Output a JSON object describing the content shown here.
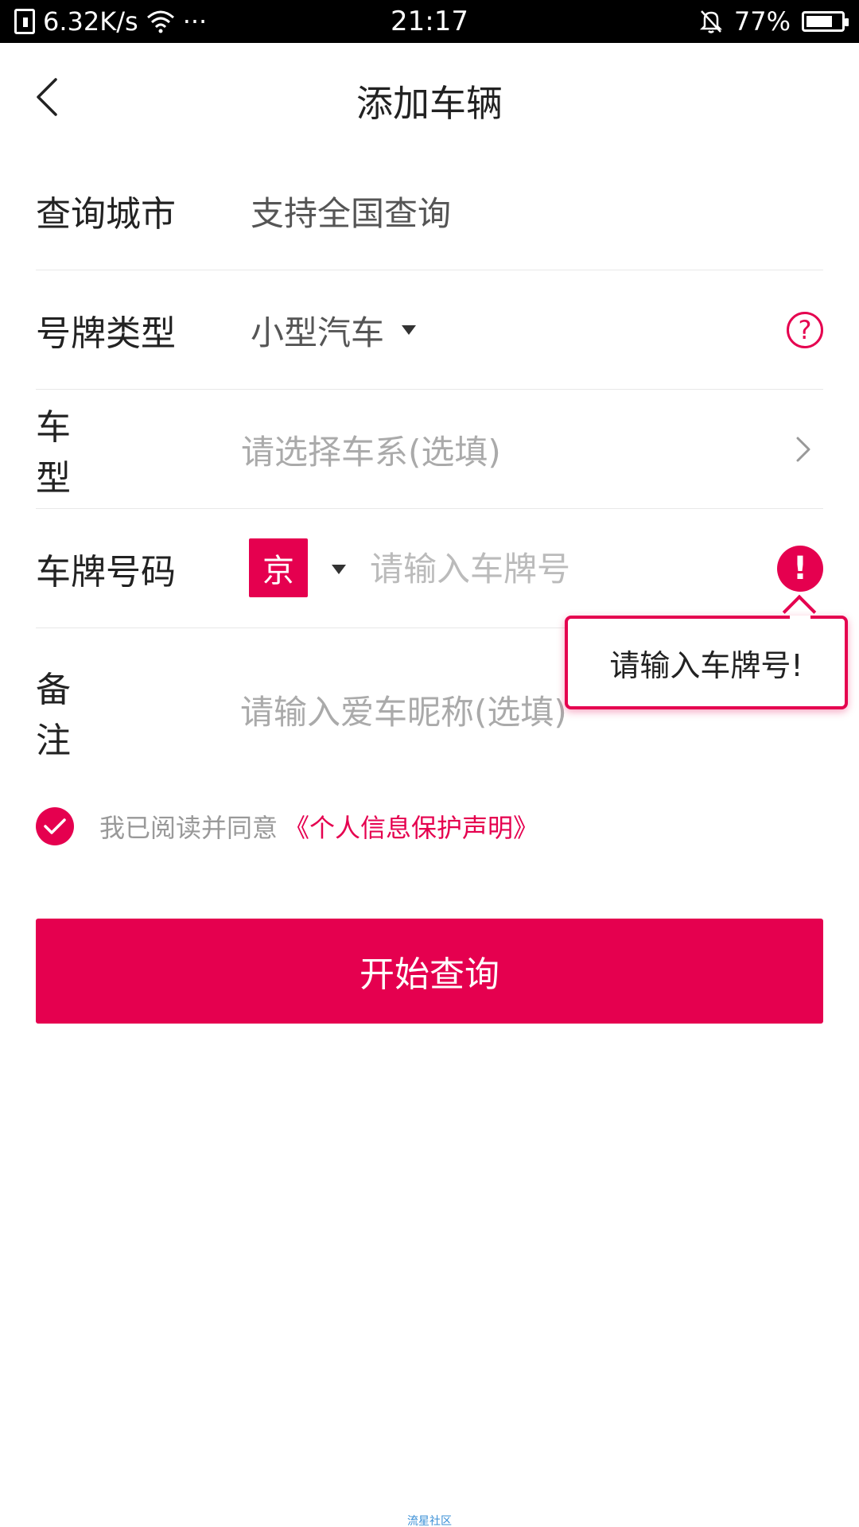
{
  "status_bar": {
    "network_speed": "6.32K/s",
    "more": "···",
    "time": "21:17",
    "battery_percent_text": "77%",
    "battery_level": 0.77
  },
  "header": {
    "title": "添加车辆",
    "back_icon": "chevron-left-icon"
  },
  "form": {
    "city": {
      "label": "查询城市",
      "value": "支持全国查询"
    },
    "plate_type": {
      "label": "号牌类型",
      "value": "小型汽车",
      "help_icon": "question-circle-icon",
      "help_glyph": "?"
    },
    "vehicle_model": {
      "label": "车型",
      "placeholder": "请选择车系(选填)"
    },
    "plate_number": {
      "label": "车牌号码",
      "province": "京",
      "placeholder": "请输入车牌号",
      "value": "",
      "error_glyph": "!"
    },
    "remark": {
      "label": "备注",
      "placeholder": "请输入爱车昵称(选填)",
      "value": ""
    }
  },
  "tooltip": {
    "message": "请输入车牌号!"
  },
  "agreement": {
    "checked": true,
    "text": "我已阅读并同意",
    "link": "《个人信息保护声明》"
  },
  "submit": {
    "label": "开始查询"
  },
  "watermark": "流星社区",
  "colors": {
    "accent": "#e5004f",
    "status_bar_bg": "#000000",
    "placeholder": "#aaaaaa"
  }
}
